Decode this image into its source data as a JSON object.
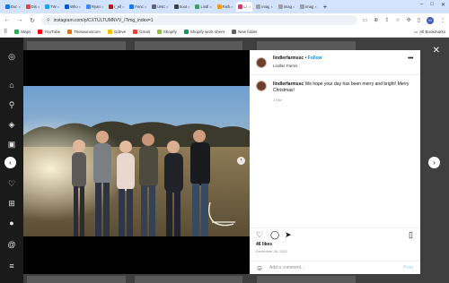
{
  "browser": {
    "tabs": [
      {
        "label": "Doc",
        "color": "#1a73e8"
      },
      {
        "label": "Dis",
        "color": "#ea4335"
      },
      {
        "label": "TW",
        "color": "#1da1f2"
      },
      {
        "label": "Who",
        "color": "#0b57d0"
      },
      {
        "label": "Ryan",
        "color": "#4285f4"
      },
      {
        "label": "r_ell",
        "color": "#c21111"
      },
      {
        "label": "Fenc",
        "color": "#1877f2"
      },
      {
        "label": "UNC",
        "color": "#5f6368"
      },
      {
        "label": "Sout",
        "color": "#3c4043"
      },
      {
        "label": "Lindl",
        "color": "#34a853"
      },
      {
        "label": "Fath",
        "color": "#f29900"
      },
      {
        "label": "Li",
        "color": "#e1306c",
        "active": true
      },
      {
        "label": "imag",
        "color": "#9aa0a6"
      },
      {
        "label": "imag",
        "color": "#9aa0a6"
      },
      {
        "label": "imag",
        "color": "#9aa0a6"
      }
    ],
    "url": "instagram.com/p/CXTULTUMNVV_/?img_index=1",
    "bookmarks": [
      {
        "label": "Maps",
        "color": "#34a853"
      },
      {
        "label": "YouTube",
        "color": "#ff0000"
      },
      {
        "label": "Thesauruscom",
        "color": "#e8710a"
      },
      {
        "label": "Gdrive",
        "color": "#fbbc04"
      },
      {
        "label": "Gmail",
        "color": "#ea4335"
      },
      {
        "label": "Shopify",
        "color": "#95bf47"
      },
      {
        "label": "Shopify work sheet",
        "color": "#0f9d58"
      },
      {
        "label": "New folder",
        "color": "#5f6368"
      }
    ],
    "all_bookmarks": "All Bookmarks",
    "profile_initial": "M"
  },
  "post": {
    "username": "lindlerfarmssc",
    "follow": "Follow",
    "subname": "Lindler Farms",
    "caption_user": "lindlerfarmssc",
    "caption_text": "We hope your day has been merry and bright! Merry Christmas!",
    "caption_time": "170w",
    "likes": "46 likes",
    "date": "December 26, 2021",
    "comment_placeholder": "Add a comment...",
    "post_label": "Post"
  },
  "colors": {
    "accent": "#0095f6",
    "sidebar_bg": "#1a1a1a",
    "overlay_bg": "#3f3f3f"
  },
  "icons": {
    "sidebar": [
      "instagram-icon",
      "home-icon",
      "search-icon",
      "explore-icon",
      "reels-icon",
      "messages-icon",
      "notifications-icon",
      "create-icon",
      "profile-icon",
      "threads-icon",
      "menu-icon"
    ],
    "actions": [
      "heart-icon",
      "comment-icon",
      "share-icon",
      "bookmark-icon"
    ]
  }
}
